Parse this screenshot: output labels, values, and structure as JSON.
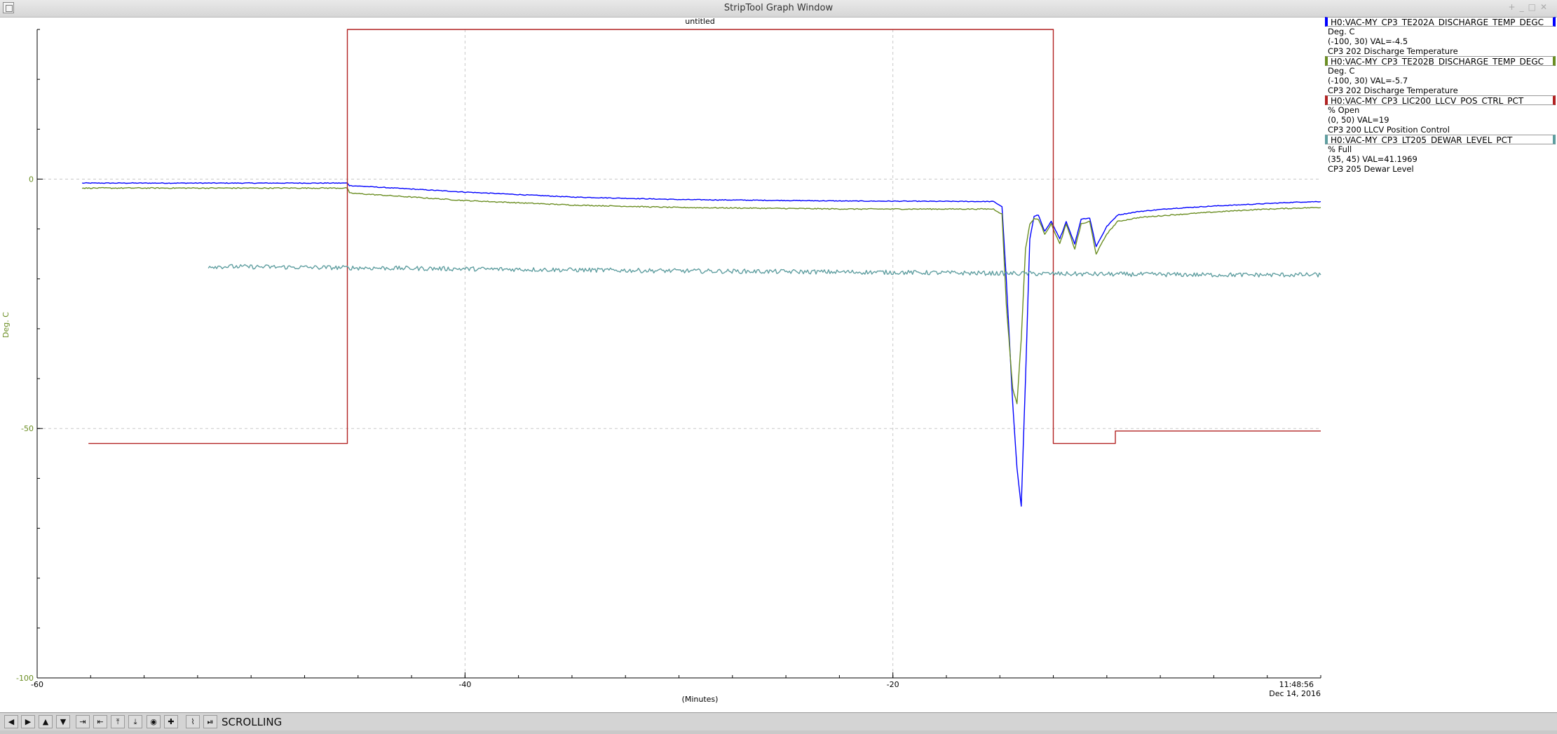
{
  "window": {
    "title": "StripTool Graph Window"
  },
  "graph": {
    "title": "untitled",
    "y_axis_label": "Deg. C",
    "x_axis_label": "(Minutes)",
    "timestamp_time": "11:48:56",
    "timestamp_date": "Dec 14, 2016",
    "x_ticks": [
      "-60",
      "-40",
      "-20"
    ],
    "y_ticks": [
      "0",
      "-50",
      "-100"
    ]
  },
  "legend": {
    "entries": [
      {
        "name": "H0:VAC-MY_CP3_TE202A_DISCHARGE_TEMP_DEGC",
        "units": "Deg. C",
        "range_val": "(-100, 30) VAL=-4.5",
        "description": "CP3 202 Discharge Temperature",
        "color": "#0000ff"
      },
      {
        "name": "H0:VAC-MY_CP3_TE202B_DISCHARGE_TEMP_DEGC",
        "units": "Deg. C",
        "range_val": "(-100, 30) VAL=-5.7",
        "description": "CP3 202 Discharge Temperature",
        "color": "#6b8e23"
      },
      {
        "name": "H0:VAC-MY_CP3_LIC200_LLCV_POS_CTRL_PCT",
        "units": "% Open",
        "range_val": "(0, 50) VAL=19",
        "description": "CP3 200 LLCV Position Control",
        "color": "#b22222"
      },
      {
        "name": "H0:VAC-MY_CP3_LT205_DEWAR_LEVEL_PCT",
        "units": "% Full",
        "range_val": "(35, 45) VAL=41.1969",
        "description": "CP3 205 Dewar Level",
        "color": "#5f9ea0"
      }
    ]
  },
  "toolbar": {
    "status": "SCROLLING",
    "buttons": [
      {
        "icon": "arrow-left-icon",
        "glyph": "◀"
      },
      {
        "icon": "arrow-right-icon",
        "glyph": "▶"
      },
      {
        "icon": "arrow-up-icon",
        "glyph": "▲"
      },
      {
        "icon": "arrow-down-icon",
        "glyph": "▼"
      },
      {
        "icon": "zoom-in-x-icon",
        "glyph": "⇥"
      },
      {
        "icon": "zoom-out-x-icon",
        "glyph": "⇤"
      },
      {
        "icon": "zoom-in-y-icon",
        "glyph": "⤒"
      },
      {
        "icon": "zoom-out-y-icon",
        "glyph": "⤓"
      },
      {
        "icon": "auto-scale-icon",
        "glyph": "◉"
      },
      {
        "icon": "reset-icon",
        "glyph": "✚"
      },
      {
        "icon": "graph-icon",
        "glyph": "⌇"
      },
      {
        "icon": "pause-icon",
        "glyph": "⏯"
      }
    ]
  },
  "chart_data": {
    "type": "line",
    "title": "untitled",
    "xlabel": "(Minutes)",
    "ylabel": "Deg. C",
    "xlim": [
      -60,
      0
    ],
    "ylim": [
      -100,
      30
    ],
    "grid": true,
    "series": [
      {
        "name": "H0:VAC-MY_CP3_TE202A_DISCHARGE_TEMP_DEGC",
        "color": "#0000ff",
        "noise": 0.15,
        "x": [
          -57.9,
          -45.5,
          -45.4,
          -40,
          -35,
          -30,
          -22,
          -15.3,
          -14.9,
          -14.7,
          -14.4,
          -14.2,
          -14.0,
          -13.8,
          -13.6,
          -13.4,
          -13.2,
          -12.9,
          -12.6,
          -12.2,
          -11.9,
          -11.5,
          -11.2,
          -10.8,
          -10.5,
          -10.0,
          -9.5,
          -8.5,
          -7,
          -5,
          -3,
          -1,
          0
        ],
        "y": [
          -0.8,
          -0.8,
          -1.3,
          -2.6,
          -3.6,
          -4.1,
          -4.4,
          -4.5,
          -5.5,
          -20,
          -45,
          -58,
          -65.5,
          -40,
          -12,
          -7.5,
          -7.2,
          -10.5,
          -8.5,
          -12,
          -8.5,
          -13,
          -8,
          -7.8,
          -13.5,
          -9.5,
          -7.2,
          -6.5,
          -5.9,
          -5.4,
          -5.0,
          -4.6,
          -4.5
        ]
      },
      {
        "name": "H0:VAC-MY_CP3_TE202B_DISCHARGE_TEMP_DEGC",
        "color": "#6b8e23",
        "noise": 0.2,
        "x": [
          -57.9,
          -45.5,
          -45.4,
          -40,
          -35,
          -30,
          -22,
          -15.3,
          -14.9,
          -14.7,
          -14.4,
          -14.2,
          -14.0,
          -13.8,
          -13.6,
          -13.4,
          -13.2,
          -12.9,
          -12.6,
          -12.2,
          -11.9,
          -11.5,
          -11.2,
          -10.8,
          -10.5,
          -10.0,
          -9.5,
          -8.5,
          -7,
          -5,
          -3,
          -1,
          0
        ],
        "y": [
          -1.8,
          -1.8,
          -2.8,
          -4.3,
          -5.2,
          -5.7,
          -6.0,
          -6.0,
          -7,
          -25,
          -42,
          -45,
          -32,
          -14,
          -9,
          -8,
          -8,
          -11,
          -9,
          -13,
          -9,
          -14,
          -9,
          -8.5,
          -15,
          -11,
          -8.5,
          -7.7,
          -7.2,
          -6.6,
          -6.1,
          -5.8,
          -5.7
        ]
      },
      {
        "name": "H0:VAC-MY_CP3_LIC200_LLCV_POS_CTRL_PCT",
        "color": "#b22222",
        "noise": 0,
        "x": [
          -57.6,
          -45.5,
          -45.5,
          -12.5,
          -12.5,
          -9.6,
          -9.6,
          0
        ],
        "y": [
          -53,
          -53,
          30,
          30,
          -53,
          -53,
          -50.5,
          -50.5
        ]
      },
      {
        "name": "H0:VAC-MY_CP3_LT205_DEWAR_LEVEL_PCT",
        "color": "#5f9ea0",
        "noise": 0.9,
        "x": [
          -52,
          -40,
          -30,
          -20,
          -12,
          -5,
          0
        ],
        "y": [
          -17.5,
          -18,
          -18.4,
          -18.7,
          -19,
          -19.2,
          -19.2
        ]
      }
    ]
  }
}
